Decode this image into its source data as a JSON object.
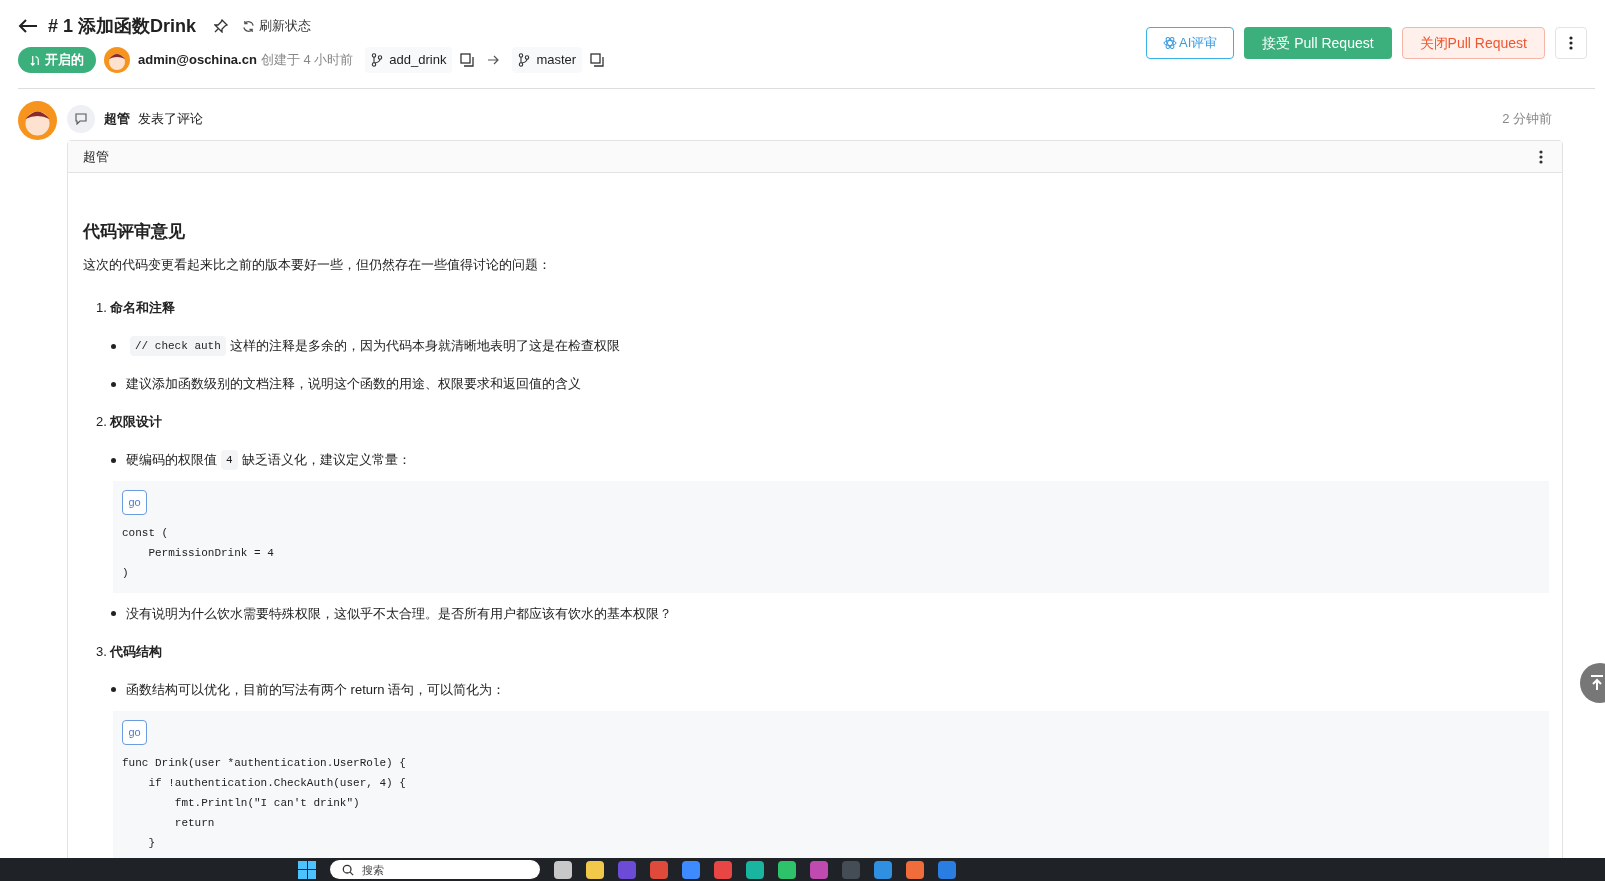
{
  "header": {
    "title": "# 1 添加函数Drink",
    "refresh": "刷新状态",
    "status": "开启的",
    "author": "admin@oschina.cn",
    "created": "创建于 4 小时前",
    "source_branch": "add_drink",
    "target_branch": "master"
  },
  "actions": [
    {
      "kind": "ai",
      "label": "AI评审"
    },
    {
      "kind": "accept",
      "label": "接受 Pull Request"
    },
    {
      "kind": "close",
      "label": "关闭Pull Request"
    }
  ],
  "comment": {
    "author": "超管",
    "action": "发表了评论",
    "time": "2 分钟前",
    "card_title": "超管",
    "body": [
      {
        "kind": "heading",
        "text": "代码评审意见"
      },
      {
        "kind": "paragraph",
        "text": "这次的代码变更看起来比之前的版本要好一些，但仍然存在一些值得讨论的问题："
      },
      {
        "kind": "section",
        "number": "1.",
        "title": "命名和注释",
        "items": [
          {
            "kind": "bullet",
            "parts": [
              {
                "code": "// check auth"
              },
              {
                "text": "这样的注释是多余的，因为代码本身就清晰地表明了这是在检查权限"
              }
            ]
          },
          {
            "kind": "bullet",
            "parts": [
              {
                "text": "建议添加函数级别的文档注释，说明这个函数的用途、权限要求和返回值的含义"
              }
            ]
          }
        ]
      },
      {
        "kind": "section",
        "number": "2.",
        "title": "权限设计",
        "items": [
          {
            "kind": "bullet",
            "parts": [
              {
                "text": "硬编码的权限值"
              },
              {
                "code": "4"
              },
              {
                "text": "缺乏语义化，建议定义常量："
              }
            ]
          },
          {
            "kind": "code",
            "lang": "go",
            "lines": [
              "const (",
              "    PermissionDrink = 4",
              ")"
            ]
          },
          {
            "kind": "bullet",
            "parts": [
              {
                "text": "没有说明为什么饮水需要特殊权限，这似乎不太合理。是否所有用户都应该有饮水的基本权限？"
              }
            ]
          }
        ]
      },
      {
        "kind": "section",
        "number": "3.",
        "title": "代码结构",
        "items": [
          {
            "kind": "bullet",
            "parts": [
              {
                "text": "函数结构可以优化，目前的写法有两个 return 语句，可以简化为："
              }
            ]
          },
          {
            "kind": "code",
            "lang": "go",
            "lines": [
              "func Drink(user *authentication.UserRole) {",
              "    if !authentication.CheckAuth(user, 4) {",
              "        fmt.Println(\"I can't drink\")",
              "        return",
              "    }"
            ]
          }
        ]
      }
    ]
  },
  "taskbar": {
    "search_placeholder": "搜索"
  }
}
